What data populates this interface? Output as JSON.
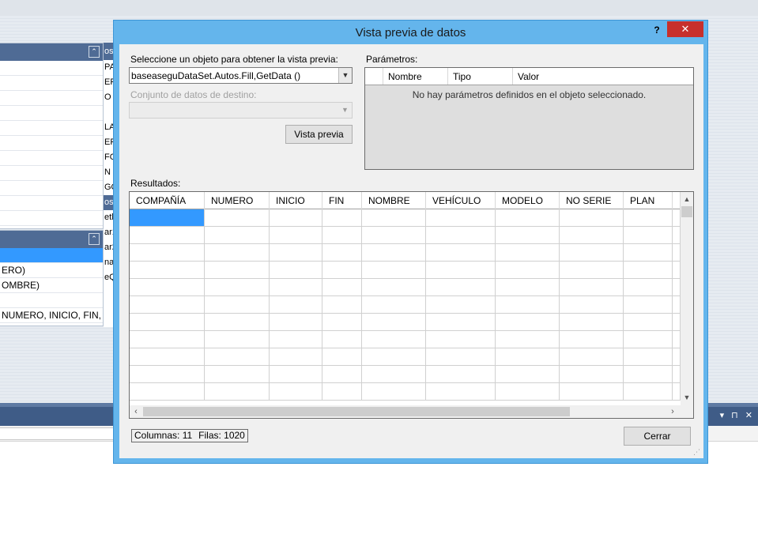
{
  "background": {
    "panel1_rows": [
      "",
      "",
      "",
      "",
      "",
      "",
      "",
      "",
      "",
      "",
      ""
    ],
    "col2_header": "os",
    "col2_rows": [
      "PA",
      "ER",
      "O",
      "",
      "LA",
      "ER",
      "FO",
      "N",
      "GO"
    ],
    "col2_header2": "os",
    "col2_rows2": [
      "etl",
      "ar1",
      "ar2",
      "na",
      "eQ"
    ],
    "panel2_rows": [
      "",
      "ERO)",
      "OMBRE)",
      "",
      "NUMERO, INICIO, FIN, ..."
    ],
    "collapse_glyph": "⌃",
    "bottom_icons": "▾ ⊓ ✕"
  },
  "dialog": {
    "title": "Vista previa de datos",
    "help_label": "?",
    "close_label": "✕",
    "select_object_label": "Seleccione un objeto para obtener la vista previa:",
    "select_object_value": "baseaseguDataSet.Autos.Fill,GetData ()",
    "target_dataset_label": "Conjunto de datos de destino:",
    "target_dataset_value": "",
    "preview_button": "Vista previa",
    "parameters_label": "Parámetros:",
    "parameters_columns": [
      "Nombre",
      "Tipo",
      "Valor"
    ],
    "parameters_empty": "No hay parámetros definidos en el objeto seleccionado.",
    "results_label": "Resultados:",
    "results_columns": [
      "COMPAÑÍA",
      "NUMERO",
      "INICIO",
      "FIN",
      "NOMBRE",
      "VEHÍCULO",
      "MODELO",
      "NO SERIE",
      "PLAN",
      ""
    ],
    "status_columns": "Columnas: 11",
    "status_rows": "Filas: 1020",
    "close_button": "Cerrar",
    "icons": {
      "combo_arrow": "chevron-down-icon",
      "scroll_up": "chevron-up-icon",
      "scroll_down": "chevron-down-icon",
      "scroll_left": "chevron-left-icon",
      "scroll_right": "chevron-right-icon",
      "resize_grip": "resize-grip-icon"
    }
  },
  "colors": {
    "dialog_frame": "#64b5ec",
    "close_red": "#c7302c",
    "selection_blue": "#3399ff",
    "ide_panel_header": "#4f6b95"
  }
}
